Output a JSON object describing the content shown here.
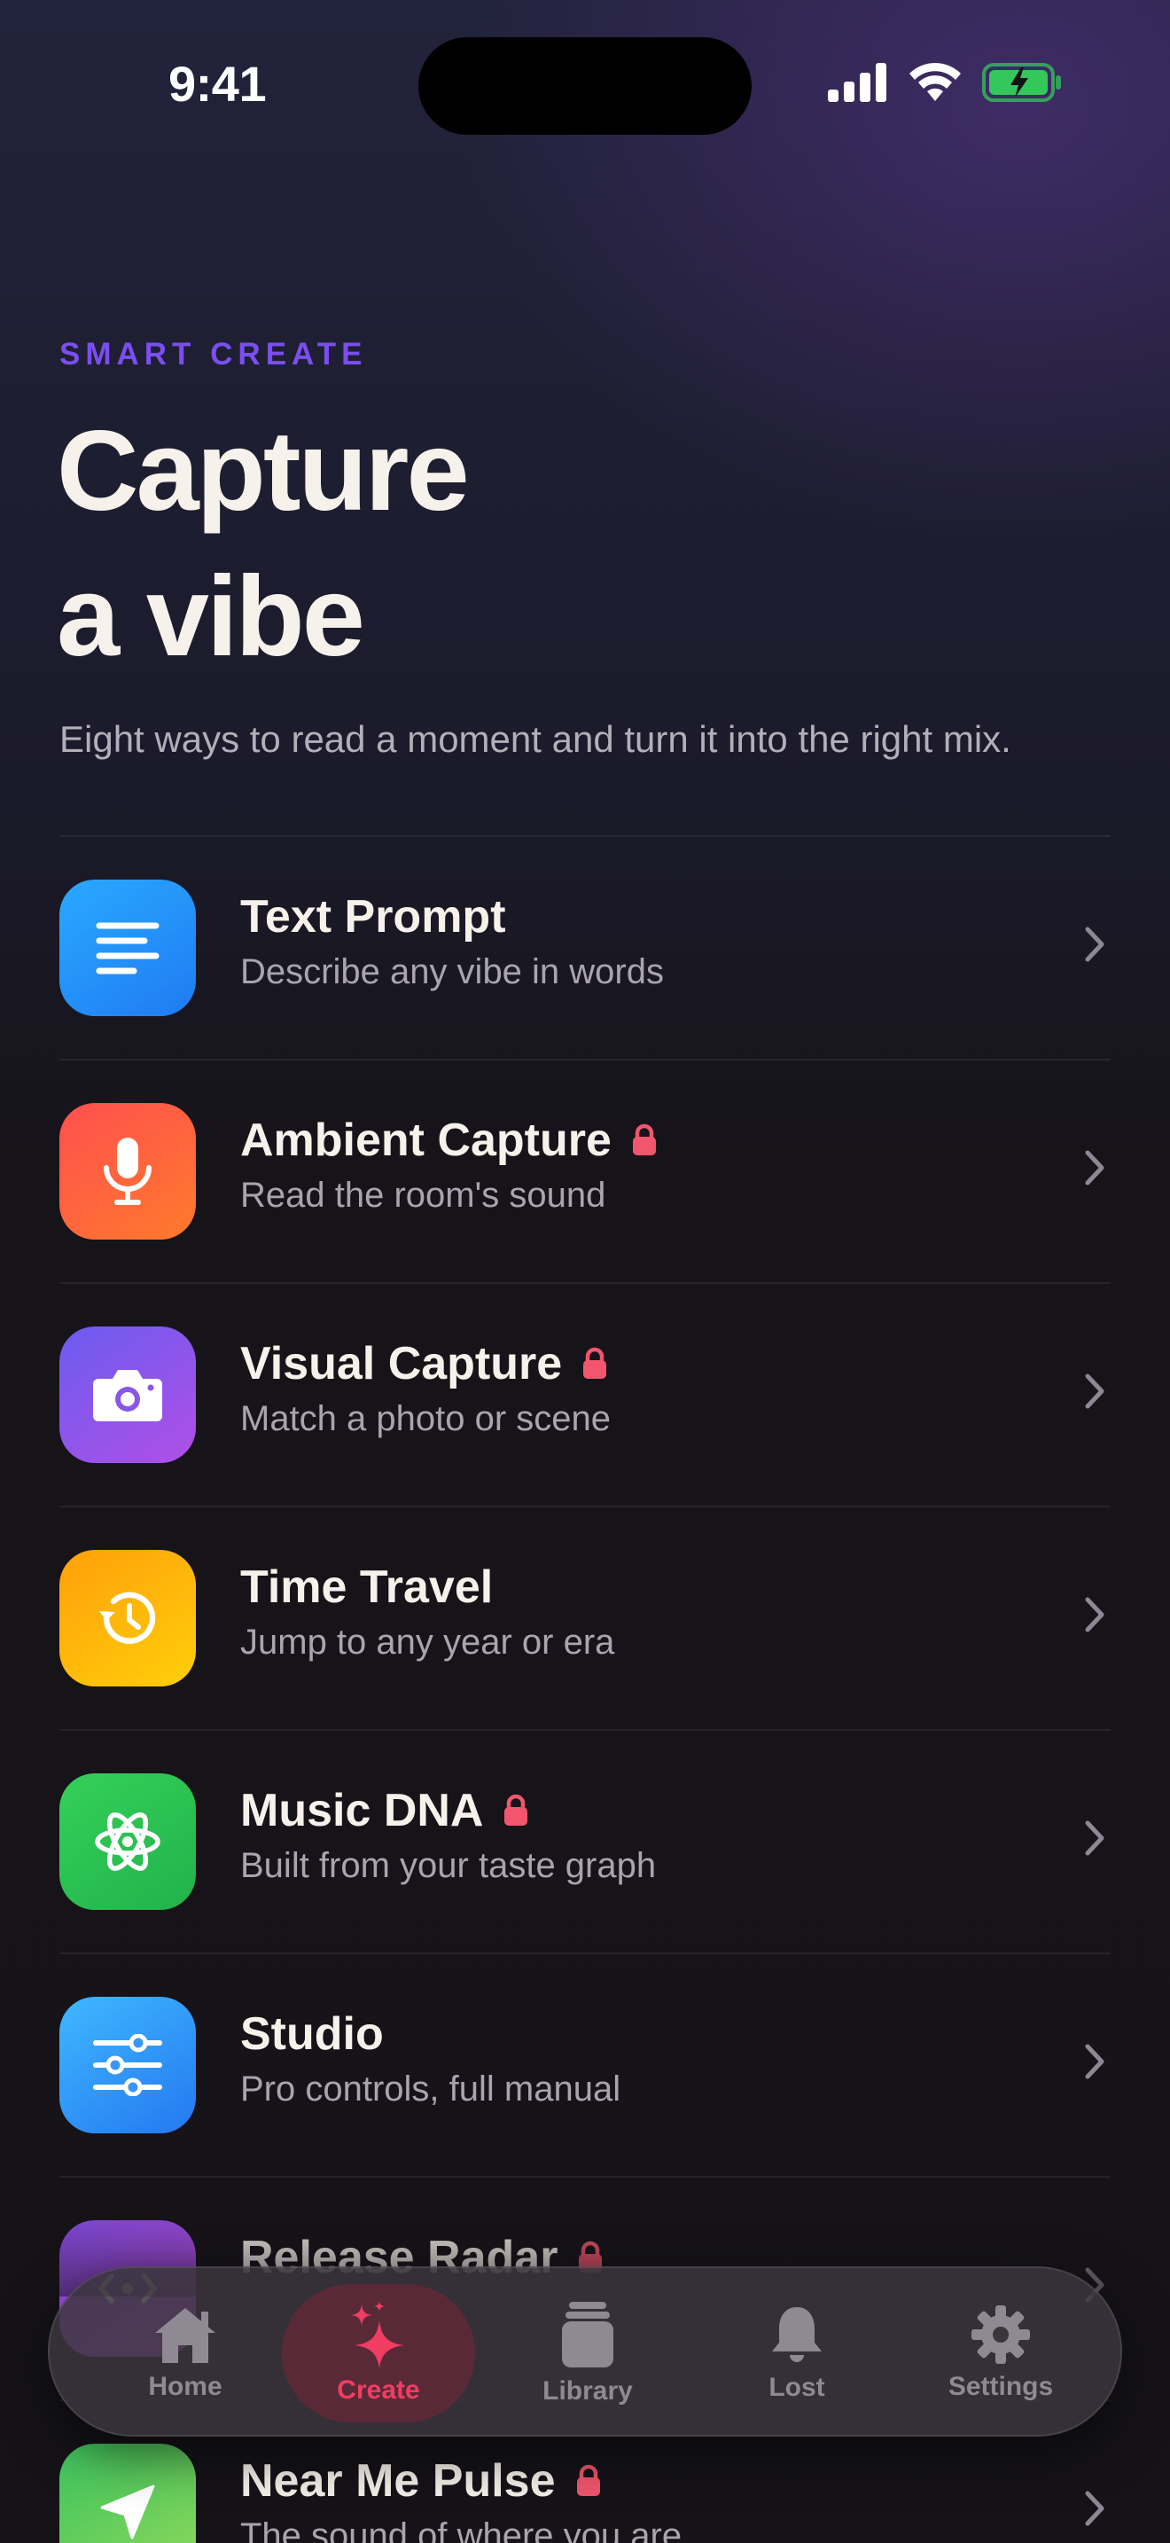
{
  "status_bar": {
    "time": "9:41"
  },
  "header": {
    "eyebrow": "SMART CREATE",
    "title_line1": "Capture",
    "title_line2": "a vibe",
    "subtitle": "Eight ways to read a moment and turn it into the right mix."
  },
  "modes": [
    {
      "title": "Text Prompt",
      "subtitle": "Describe any vibe in words",
      "locked": false,
      "icon": "text-lines-icon"
    },
    {
      "title": "Ambient Capture",
      "subtitle": "Read the room's sound",
      "locked": true,
      "icon": "microphone-icon"
    },
    {
      "title": "Visual Capture",
      "subtitle": "Match a photo or scene",
      "locked": true,
      "icon": "camera-icon"
    },
    {
      "title": "Time Travel",
      "subtitle": "Jump to any year or era",
      "locked": false,
      "icon": "history-clock-icon"
    },
    {
      "title": "Music DNA",
      "subtitle": "Built from your taste graph",
      "locked": true,
      "icon": "atom-icon"
    },
    {
      "title": "Studio",
      "subtitle": "Pro controls, full manual",
      "locked": false,
      "icon": "sliders-icon"
    },
    {
      "title": "Release Radar",
      "subtitle": "",
      "locked": true,
      "icon": "radar-icon"
    },
    {
      "title": "Near Me Pulse",
      "subtitle": "The sound of where you are",
      "locked": true,
      "icon": "location-arrow-icon"
    }
  ],
  "tabbar": {
    "tabs": [
      {
        "label": "Home",
        "icon": "house-icon",
        "active": false
      },
      {
        "label": "Create",
        "icon": "sparkles-icon",
        "active": true
      },
      {
        "label": "Library",
        "icon": "library-stack-icon",
        "active": false
      },
      {
        "label": "Lost",
        "icon": "bell-icon",
        "active": false
      },
      {
        "label": "Settings",
        "icon": "gear-icon",
        "active": false
      }
    ]
  },
  "colors": {
    "accent_purple": "#7b4ef0",
    "lock_pink": "#f2566f",
    "tab_active": "#f13d62",
    "battery_green": "#34c759"
  }
}
